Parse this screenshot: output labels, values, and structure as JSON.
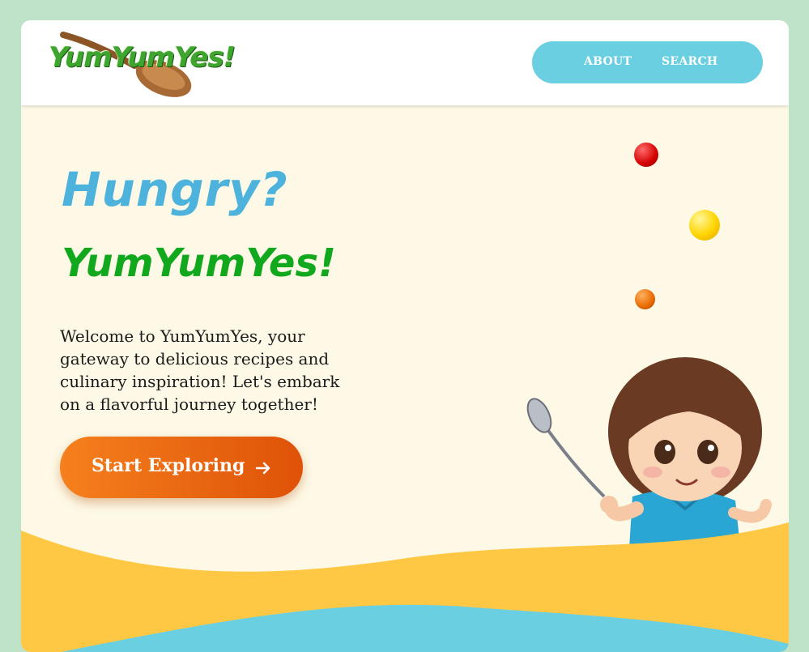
{
  "header": {
    "logo_text": "YumYumYes!",
    "nav": [
      {
        "label": "ABOUT"
      },
      {
        "label": "SEARCH"
      }
    ]
  },
  "hero": {
    "headline": "Hungry?",
    "brand": "YumYumYes!",
    "intro": "Welcome to YumYumYes, your gateway to delicious recipes and culinary inspiration! Let's embark on a flavorful journey together!",
    "cta_label": "Start Exploring",
    "cta_icon": "arrow-right-icon"
  },
  "colors": {
    "page_bg": "#bfe3c8",
    "hero_bg": "#fdf9e6",
    "nav_bg": "#6bcfe2",
    "headline": "#4db3dc",
    "brand": "#12a81e",
    "cta_start": "#f5801d",
    "cta_end": "#df5208",
    "wave_yellow": "#fec845",
    "wave_blue": "#6bcfe2"
  }
}
